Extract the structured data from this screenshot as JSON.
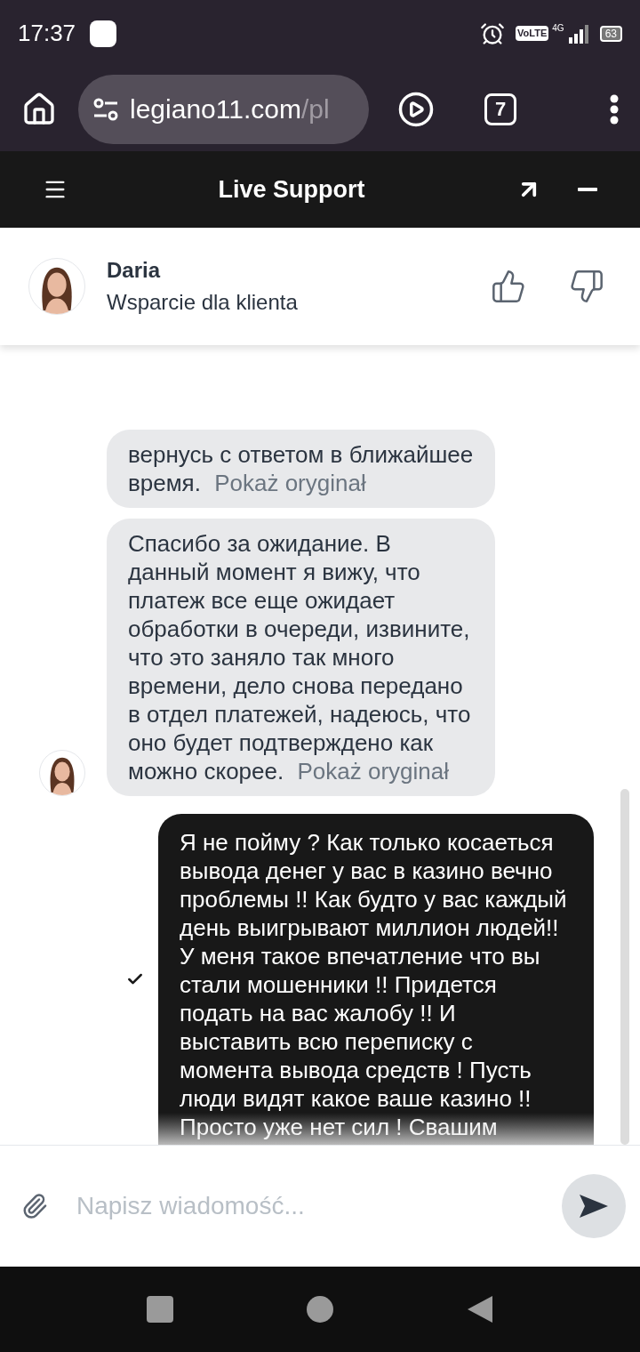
{
  "status_bar": {
    "time": "17:37",
    "network_badge": "VoLTE",
    "network_type": "4G",
    "battery": "63"
  },
  "browser": {
    "url_host": "legiano11.com",
    "url_path": "/pl",
    "tab_count": "7"
  },
  "widget": {
    "title": "Live Support"
  },
  "agent": {
    "name": "Daria",
    "role": "Wsparcie dla klienta"
  },
  "messages": [
    {
      "kind": "agent",
      "text": "вернусь с ответом в ближайшее время.",
      "link": "Pokaż oryginał",
      "show_avatar": false
    },
    {
      "kind": "agent",
      "text": "Спасибо за ожидание. В данный момент я вижу, что платеж все еще ожидает обработки в очереди, извините, что это заняло так много времени, дело снова передано в отдел платежей, надеюсь, что оно будет подтверждено как можно скорее.",
      "link": "Pokaż oryginał",
      "show_avatar": true
    },
    {
      "kind": "user",
      "text": "Я не пойму ? Как только косаеться вывода денег у вас в казино вечно проблемы !! Как будто у вас каждый день выигрывают миллион людей!! У меня такое впечатление что вы стали мошенники !! Придется подать на вас жалобу !! И выставить всю переписку с момента вывода средств ! Пусть люди видят какое ваше казино !!",
      "faded_text": "Просто уже нет сил ! Свашим",
      "delivered": true
    }
  ],
  "composer": {
    "placeholder": "Napisz wiadomość..."
  }
}
